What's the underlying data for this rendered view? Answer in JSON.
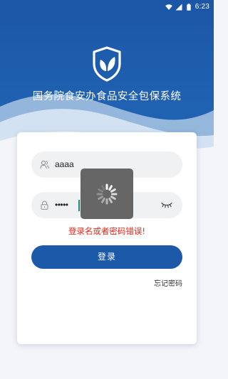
{
  "status_bar": {
    "time": "6:23",
    "icons": [
      "wifi-icon",
      "signal-icon",
      "battery-icon"
    ]
  },
  "header": {
    "logo_icon": "shield-leaf-icon",
    "title": "国务院食安办食品安全包保系统"
  },
  "login_form": {
    "username": {
      "icon": "user-icon",
      "value": "aaaa"
    },
    "password": {
      "icon": "lock-icon",
      "value": "•••••",
      "toggle_icon": "eye-closed-icon"
    },
    "error_message": "登录名或者密码错误!",
    "login_button": "登录",
    "forgot_password": "忘记密码"
  },
  "loading": {
    "icon": "spinner-icon",
    "visible": true
  },
  "colors": {
    "header_blue": "#1d5fae",
    "primary_button": "#1c5aa9",
    "error": "#e0281c",
    "field_bg": "#f0f1f3"
  }
}
